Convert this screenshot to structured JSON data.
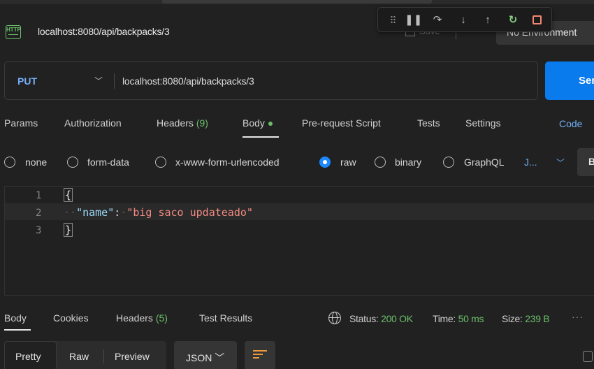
{
  "window": {
    "tab_title": "localhost:8080/api/backpacks/3",
    "save_label": "Save",
    "environment_label": "No Environment"
  },
  "debug_toolbar": {
    "icons": [
      "drag-handle-icon",
      "pause-icon",
      "step-over-icon",
      "step-into-icon",
      "step-out-icon",
      "restart-icon",
      "stop-icon"
    ]
  },
  "request": {
    "method": "PUT",
    "url": "localhost:8080/api/backpacks/3",
    "send_label": "Send"
  },
  "request_tabs": {
    "params": "Params",
    "authorization": "Authorization",
    "headers": "Headers",
    "headers_count": "(9)",
    "body": "Body",
    "prerequest": "Pre-request Script",
    "tests": "Tests",
    "settings": "Settings",
    "code": "Code"
  },
  "body_types": {
    "none": "none",
    "form_data": "form-data",
    "urlencoded": "x-www-form-urlencoded",
    "raw": "raw",
    "binary": "binary",
    "graphql": "GraphQL",
    "raw_format": "J...",
    "beautify": "B",
    "selected": "raw"
  },
  "editor": {
    "line_numbers": [
      "1",
      "2",
      "3"
    ],
    "line1": "{",
    "line2_key": "\"name\"",
    "line2_colon": ":",
    "line2_value": "\"big saco updateado\"",
    "line3": "}"
  },
  "response_tabs": {
    "body": "Body",
    "cookies": "Cookies",
    "headers": "Headers",
    "headers_count": "(5)",
    "test_results": "Test Results"
  },
  "response_status": {
    "status_label": "Status:",
    "status_value": "200 OK",
    "time_label": "Time:",
    "time_value": "50 ms",
    "size_label": "Size:",
    "size_value": "239 B",
    "more": "···"
  },
  "response_view": {
    "pretty": "Pretty",
    "raw": "Raw",
    "preview": "Preview",
    "format": "JSON",
    "active": "Pretty"
  },
  "colors": {
    "accent_blue": "#097bed",
    "method_blue": "#74aef6",
    "success_green": "#6bbf6b",
    "json_key": "#9cdcfe",
    "json_string": "#f28b82",
    "wrap_orange": "#f0983e"
  }
}
